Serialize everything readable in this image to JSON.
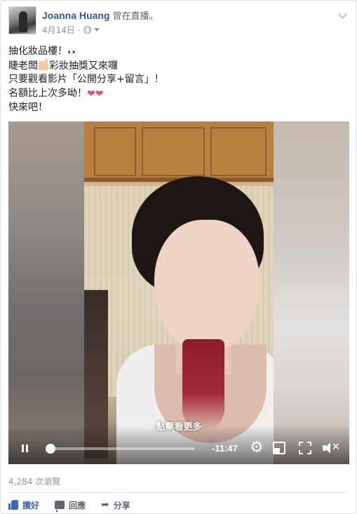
{
  "post": {
    "author": "Joanna Huang",
    "status": "曾在直播。",
    "date": "4月14日 ·",
    "lines": {
      "l1": "抽化妝品樓！",
      "l2a": "睫老闆",
      "l2b": "彩妝抽獎又來囉",
      "l3": "只要觀看影片「公開分享+留言」！",
      "l4": "名額比上次多呦！",
      "l5": "快來吧！"
    },
    "emojis": {
      "eyes": "👀",
      "heart": "❤❤"
    }
  },
  "video": {
    "hint": "點擊看更多",
    "time_remaining": "-11:47",
    "progress": 0.0
  },
  "footer": {
    "views": "4,284 次瀏覽",
    "like": "讚好",
    "comment": "回應",
    "share": "分享"
  },
  "colors": {
    "link": "#365899",
    "like_blue": "#4267b2",
    "meta_gray": "#90949c"
  }
}
